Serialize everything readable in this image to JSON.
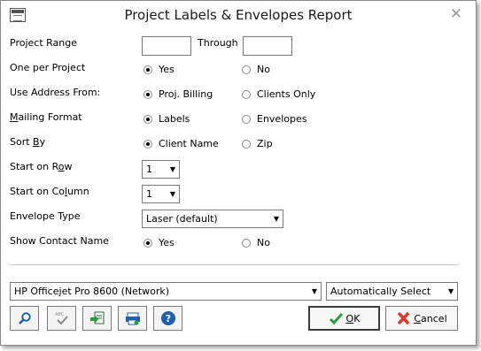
{
  "window": {
    "title": "Project Labels & Envelopes Report"
  },
  "form": {
    "project_range": {
      "label": "Project Range",
      "from": "",
      "through_label": "Through",
      "through": ""
    },
    "one_per_project": {
      "label": "One per Project",
      "options": [
        "Yes",
        "No"
      ],
      "selected": "Yes"
    },
    "use_address_from": {
      "label": "Use Address From:",
      "options": [
        "Proj. Billing",
        "Clients Only"
      ],
      "selected": "Proj. Billing"
    },
    "mailing_format": {
      "label_pre": "",
      "label_ul": "M",
      "label_post": "ailing Format",
      "options": [
        "Labels",
        "Envelopes"
      ],
      "selected": "Labels"
    },
    "sort_by": {
      "label_pre": "Sort ",
      "label_ul": "B",
      "label_post": "y",
      "options": [
        "Client Name",
        "Zip"
      ],
      "selected": "Client Name"
    },
    "start_on_row": {
      "label_pre": "Start on R",
      "label_ul": "o",
      "label_post": "w",
      "value": "1"
    },
    "start_on_column": {
      "label_pre": "Start on Co",
      "label_ul": "l",
      "label_post": "umn",
      "value": "1"
    },
    "envelope_type": {
      "label": "Envelope Type",
      "value": "Laser (default)"
    },
    "show_contact_name": {
      "label": "Show Contact Name",
      "options": [
        "Yes",
        "No"
      ],
      "selected": "Yes"
    }
  },
  "printer": {
    "name": "HP Officejet Pro 8600 (Network)",
    "tray": "Automatically Select"
  },
  "toolbar": {
    "icons": [
      "magnifier-icon",
      "spellcheck-icon",
      "export-icon",
      "printer-setup-icon",
      "help-icon"
    ]
  },
  "buttons": {
    "ok_pre": "",
    "ok_ul": "O",
    "ok_post": "K",
    "cancel_pre": "",
    "cancel_ul": "C",
    "cancel_post": "ancel"
  },
  "colors": {
    "ok_check": "#2e9b3e",
    "cancel_x": "#e0352a",
    "tool_icon_blue": "#1f5fb0"
  }
}
